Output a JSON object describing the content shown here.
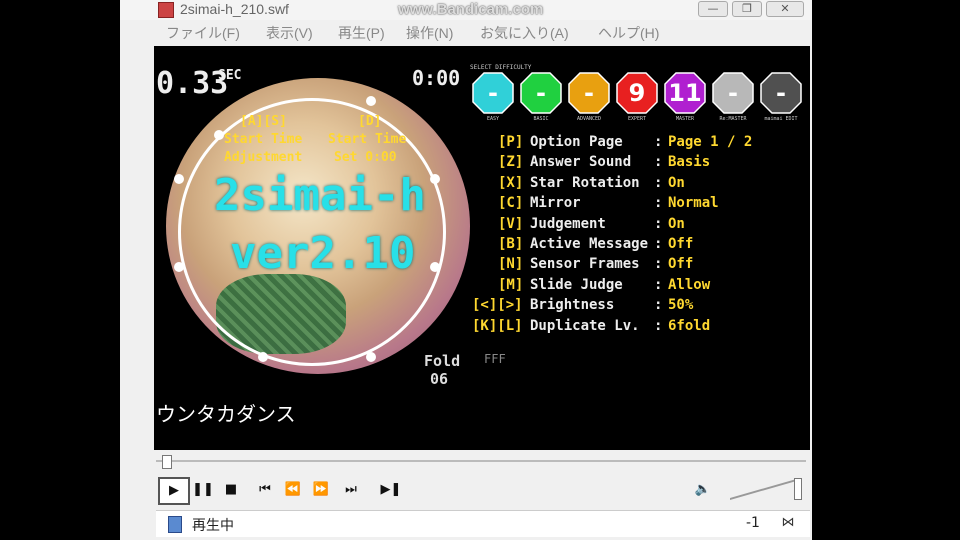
{
  "window": {
    "title": "2simai-h_210.swf",
    "watermark": "www.Bandicam.com",
    "controls": {
      "minimize": "—",
      "maximize": "❐",
      "close": "✕"
    }
  },
  "menu": [
    "ファイル(F)",
    "表示(V)",
    "再生(P)",
    "操作(N)",
    "お気に入り(A)",
    "ヘルプ(H)"
  ],
  "game": {
    "sec_value": "0.33",
    "sec_unit": "SEC",
    "time": "0:00",
    "title_line1": "2simai-h",
    "title_line2": "ver2.10",
    "start_a_key": "[A][S]",
    "start_a_line1": "Start Time",
    "start_a_line2": "Adjustment",
    "start_d_key": "[D]",
    "start_d_line1": "Start Time",
    "start_d_line2": "Set 0:00",
    "select_difficulty": "SELECT DIFFICULTY",
    "difficulties": [
      {
        "label": "EASY",
        "value": "-",
        "color": "#30d0d8"
      },
      {
        "label": "BASIC",
        "value": "-",
        "color": "#20d040"
      },
      {
        "label": "ADVANCED",
        "value": "-",
        "color": "#e8a010"
      },
      {
        "label": "EXPERT",
        "value": "9",
        "color": "#e82020"
      },
      {
        "label": "MASTER",
        "value": "11",
        "color": "#b020d0"
      },
      {
        "label": "Re:MASTER",
        "value": "-",
        "color": "#b8b8b8"
      },
      {
        "label": "maimai EDIT",
        "value": "-",
        "color": "#505050"
      }
    ],
    "options": [
      {
        "key": "[P]",
        "name": "Option Page",
        "value": "Page 1 / 2"
      },
      {
        "key": "[Z]",
        "name": "Answer Sound",
        "value": "Basis"
      },
      {
        "key": "[X]",
        "name": "Star Rotation",
        "value": "On"
      },
      {
        "key": "[C]",
        "name": "Mirror",
        "value": "Normal"
      },
      {
        "key": "[V]",
        "name": "Judgement",
        "value": "On"
      },
      {
        "key": "[B]",
        "name": "Active Message",
        "value": "Off"
      },
      {
        "key": "[N]",
        "name": "Sensor Frames",
        "value": "Off"
      },
      {
        "key": "[M]",
        "name": "Slide Judge",
        "value": "Allow"
      },
      {
        "key": "[<][>]",
        "name": "Brightness",
        "value": "50%"
      },
      {
        "key": "[K][L]",
        "name": "Duplicate Lv.",
        "value": "6fold"
      }
    ],
    "fold_label": "Fold",
    "fold_value": "06",
    "fff": "FFF",
    "song_title": "ウンタカダンス"
  },
  "player": {
    "status": "再生中",
    "volume_readout": "-1"
  }
}
